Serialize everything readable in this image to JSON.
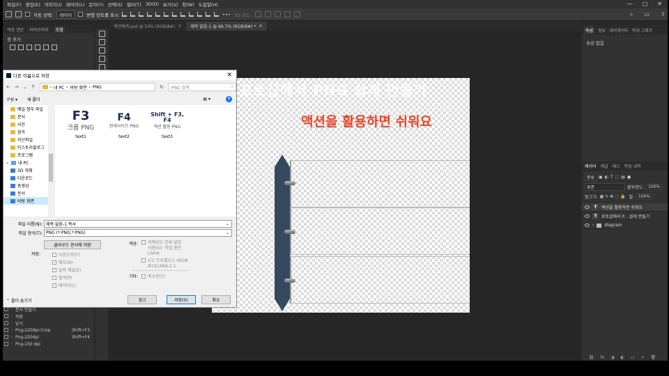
{
  "menubar": [
    "파일(F)",
    "편집(E)",
    "이미지(I)",
    "레이어(L)",
    "문자(Y)",
    "선택(S)",
    "필터(T)",
    "3D(D)",
    "보기(V)",
    "창(W)",
    "도움말(H)"
  ],
  "optbar": {
    "auto_select": "자동 선택:",
    "layer_drop": "레이어",
    "transform": "변형 컨트롤 표시",
    "mode3d": "3D 모드:"
  },
  "left_panel": {
    "tabs": [
      "색상 견본",
      "라이브러리",
      "조정"
    ],
    "add_label": "정 추가",
    "actions": [
      {
        "label": "문서 만들기",
        "key": ""
      },
      {
        "label": "저장",
        "key": ""
      },
      {
        "label": "닫기",
        "key": ""
      },
      {
        "label": "Png-220dpi-Crop",
        "key": "Shift+F3"
      },
      {
        "label": "Png-220dpi",
        "key": "Shift+F4"
      },
      {
        "label": "Png-150 dpi",
        "key": ""
      }
    ]
  },
  "doc_tabs": [
    {
      "label": "액션예제.psd @ 50% (RGB/8#)",
      "close": "×",
      "active": false
    },
    {
      "label": "제목 없음-1 @ 66.7% (RGB/8#) *",
      "close": "×",
      "active": true
    }
  ],
  "canvas": {
    "ghost_title": "포토샵에서 PNG 쉽게 만들기",
    "headline": "액션을 활용하면 쉬워요"
  },
  "right_panel": {
    "tabs": [
      "속성",
      "정보",
      "내비게이터",
      "막대 그래프"
    ],
    "no_props": "속성 없음",
    "layer_tabs": [
      "레이어",
      "채널",
      "패스",
      "작업 내역"
    ],
    "kind": "종류",
    "blend": "표준",
    "opacity_label": "불투명도:",
    "opacity": "100%",
    "lock_label": "잠그기:",
    "fill_label": "칠:",
    "fill": "100%",
    "layers": [
      {
        "type": "text",
        "name": "액션을 활용하면 쉬워요"
      },
      {
        "type": "text",
        "name": "포토샵에서 P... 쉽게 만들기"
      },
      {
        "type": "group",
        "name": "diagram"
      }
    ]
  },
  "dialog": {
    "title": "다른 이름으로 저장",
    "path": [
      "내 PC",
      "바탕 화면",
      "PNG"
    ],
    "search_placeholder": "PNG 검색",
    "organize": "구성 ▾",
    "new_folder": "새 폴더",
    "help": "?",
    "nav_items": [
      {
        "label": "메일 첨부 파일",
        "icon": "folder"
      },
      {
        "label": "문서",
        "icon": "folder"
      },
      {
        "label": "사진",
        "icon": "folder"
      },
      {
        "label": "음악",
        "icon": "folder"
      },
      {
        "label": "지난파일",
        "icon": "folder"
      },
      {
        "label": "티스토리블로그",
        "icon": "folder"
      },
      {
        "label": "프로그램",
        "icon": "folder"
      },
      {
        "label": "내 PC",
        "icon": "pc"
      },
      {
        "label": "3D 개체",
        "icon": "blue"
      },
      {
        "label": "다운로드",
        "icon": "blue"
      },
      {
        "label": "동영상",
        "icon": "blue"
      },
      {
        "label": "문서",
        "icon": "blue"
      },
      {
        "label": "바탕 화면",
        "icon": "blue"
      }
    ],
    "files": [
      {
        "big": "F3",
        "sub": "크롭 PNG",
        "name": "text1"
      },
      {
        "big": "F4",
        "sub": "현재사이즈 PNG",
        "name": "text2"
      },
      {
        "big": "Shift + F3, F4",
        "sub": "액션 활용 PNG",
        "name": "text3"
      }
    ],
    "filename_label": "파일 이름(N):",
    "filename": "제목 없음-1 복사",
    "filetype_label": "파일 형식(T):",
    "filetype": "PNG (*.PNG;*.PNG)",
    "cloud_btn": "클라우드 문서에 저장",
    "save_label": "저장:",
    "save_opts": [
      "사본으로(Y)",
      "메모(N)",
      "알파 채널(E)",
      "별색(P)",
      "레이어(L)"
    ],
    "color_label": "색상:",
    "proof": "저해상도 인쇄 설정\n사용(O): 작업 중인\nCMYK",
    "icc": "ICC 프로필(C): sRGB\nIEC61966-2.1",
    "other_label": "기타:",
    "thumbnail": "축소판(T)",
    "hide_folders": "폴더 숨기기",
    "warn_btn": "경고",
    "save_btn": "저장(S)",
    "cancel_btn": "취소"
  }
}
